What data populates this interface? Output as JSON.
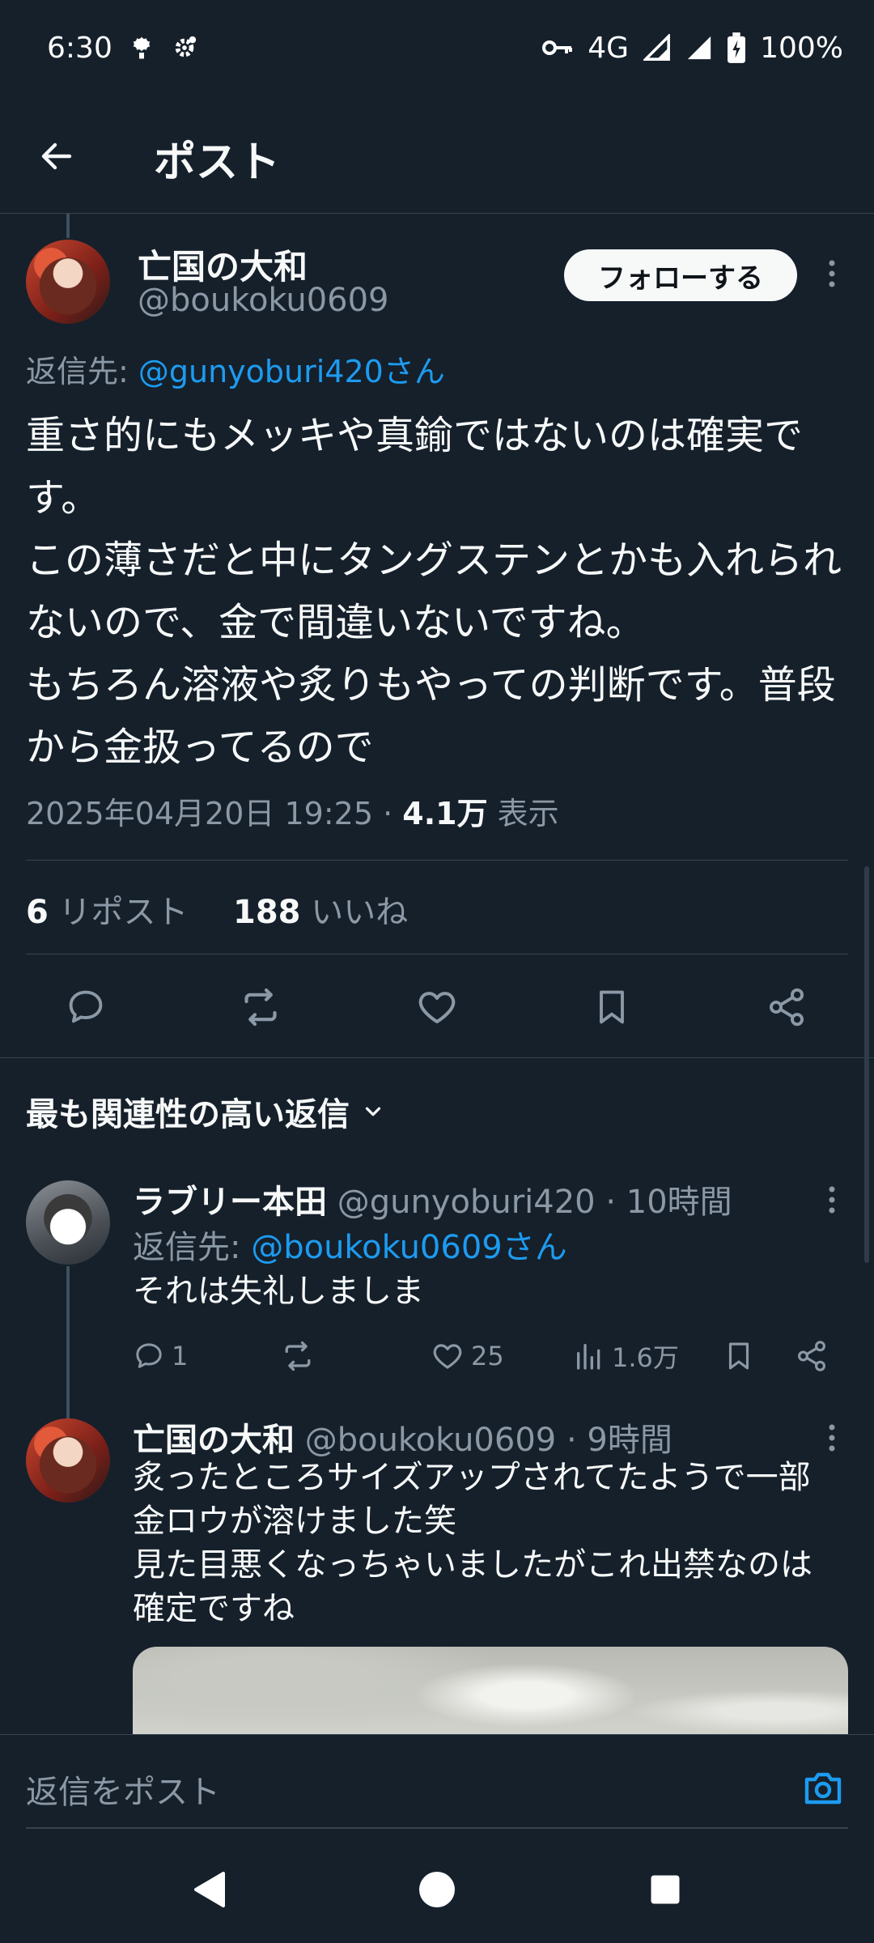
{
  "status_bar": {
    "time": "6:30",
    "network": "4G",
    "battery": "100%",
    "icons": [
      "notification-icon",
      "settings-icon",
      "vpn-key-icon",
      "signal-icon",
      "signal-icon",
      "battery-icon"
    ]
  },
  "header": {
    "title": "ポスト",
    "back_icon": "arrow-left-icon"
  },
  "tweet": {
    "author_name": "亡国の大和",
    "author_handle": "@boukoku0609",
    "follow_label": "フォローする",
    "reply_prefix": "返信先: ",
    "reply_mention": "@gunyoburi420さん",
    "body": "重さ的にもメッキや真鍮ではないのは確実です。\nこの薄さだと中にタングステンとかも入れられないので、金で間違いないですね。\nもちろん溶液や炙りもやっての判断です。普段から金扱ってるので",
    "timestamp": "2025年04月20日 19:25 · ",
    "views_count": "4.1万",
    "views_label": " 表示",
    "reposts_count": "6",
    "reposts_label": " リポスト",
    "likes_count": "188",
    "likes_label": " いいね"
  },
  "sort": {
    "label": "最も関連性の高い返信"
  },
  "replies": [
    {
      "name": "ラブリー本田",
      "handle": "@gunyoburi420",
      "time": " · 10時間",
      "reply_prefix": "返信先: ",
      "reply_mention": "@boukoku0609さん",
      "text": "それは失礼しましま",
      "replies_count": "1",
      "likes_count": "25",
      "views_count": "1.6万"
    },
    {
      "name": "亡国の大和",
      "handle": "@boukoku0609",
      "time": " · 9時間",
      "text": "炙ったところサイズアップされてたようで一部\n金ロウが溶けました笑\n見た目悪くなっちゃいましたがこれ出禁なのは\n確定ですね"
    }
  ],
  "composer": {
    "placeholder": "返信をポスト"
  },
  "colors": {
    "background": "#15202b",
    "accent": "#1d9bf0",
    "muted": "#8b98a5",
    "text": "#f7f9f9"
  }
}
